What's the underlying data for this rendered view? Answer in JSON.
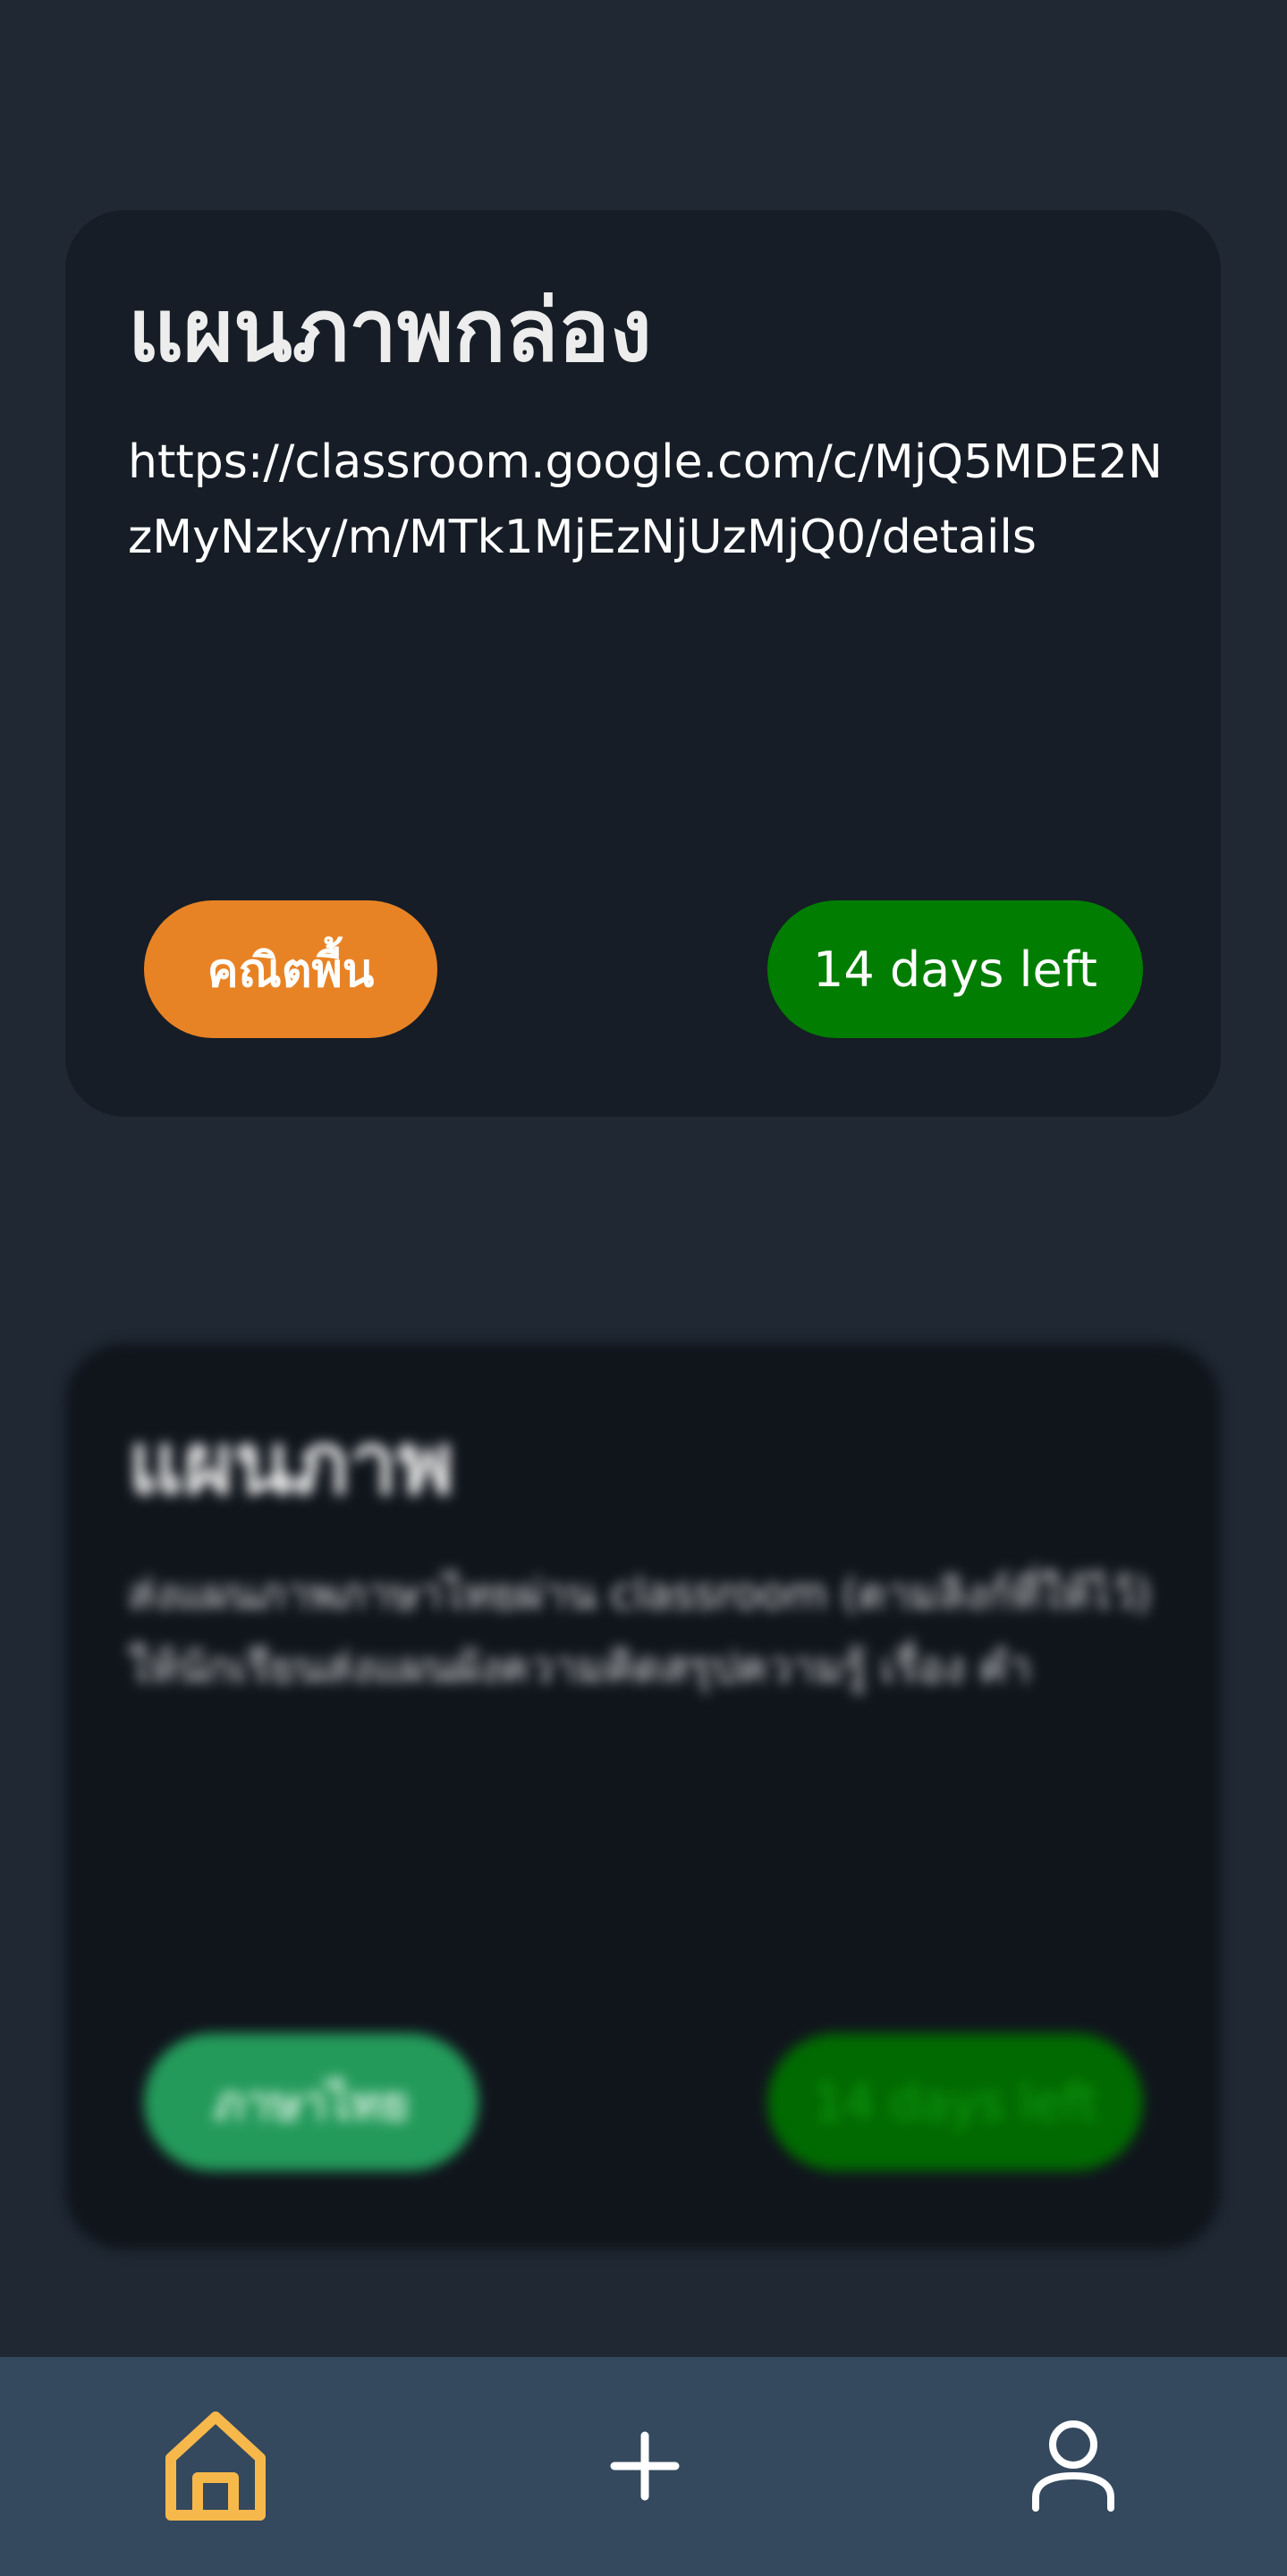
{
  "cards": [
    {
      "title": "แผนภาพกล่อง",
      "body": "https://classroom.google.com/c/MjQ5MDE2NzMyNzky/m/MTk1MjEzNjUzMjQ0/details",
      "tag": "คณิตพื้น",
      "due": "14 days left",
      "tag_color": "#e88325",
      "due_color": "#017d01"
    },
    {
      "title": "แผนภาพ",
      "body": "ส่งแผนภาพภาษาไทยผ่าน classroom (ตามลิงก์ที่ให้ไว้) ให้นักเรียนส่งแผนผังความคิดสรุปความรู้ เรื่อง คำ",
      "tag": "ภาษาไทย",
      "due": "14 days left",
      "tag_color": "#239a5a",
      "due_color": "#016a01"
    }
  ],
  "nav": {
    "home_icon": "home-icon",
    "add_icon": "plus-icon",
    "profile_icon": "user-icon",
    "active_color": "#f7b84b",
    "inactive_color": "#ffffff",
    "background": "#34495e"
  }
}
